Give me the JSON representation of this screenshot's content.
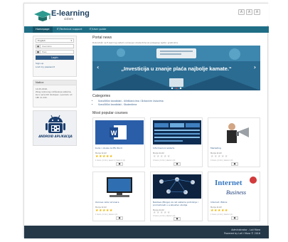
{
  "header": {
    "logo_text": "E-learning",
    "logo_sub": "sistem",
    "lang_buttons": [
      "A",
      "A",
      "A"
    ]
  },
  "nav": {
    "items": [
      "Homepage",
      "IT/Technical support",
      "IT/User guide"
    ]
  },
  "sidebar": {
    "language_select": "English",
    "username_placeholder": "Username",
    "password_placeholder": "Pass",
    "login_button": "Login",
    "signup_link": "Sign up",
    "forgot_link": "Lost my password",
    "notice_title": "Notice",
    "notice_date": "14.05.2016.",
    "notice_text": "Zbog redovnog održavanja sistema, kurs neće biti dostupan u periodu od 18h do 22h.",
    "android_text": "ANDROID APLIKACIJA"
  },
  "main": {
    "portal_title": "Portal news",
    "portal_sub": "Dobrodošli na E-learning sistem namenjen studentima za polaganje ispita i gradivima.",
    "banner_text": "„Investicija u znanje plaća najbolje kamate.“",
    "banner_prev": "‹",
    "banner_next": "›",
    "categories_title": "Categories",
    "categories": [
      "Sveučilišni kandidati - Učešćanicima i Državnim Uslovima",
      "Sveučilišni kandidati - Studentima"
    ],
    "courses_title": "Most popular courses",
    "courses": [
      {
        "title": "Kursi i obuke za MS Word",
        "sub": "Marija Krstić",
        "rated": true,
        "meta": "1 hours | 0 min | Level: 4 | Users in (1)"
      },
      {
        "title": "Informacioni sistemi",
        "sub": "Marija Krstić",
        "rated": false,
        "meta": "0 hours | 0 min | Users in (0)"
      },
      {
        "title": "Marketing",
        "sub": "Marija Krstić",
        "rated": false,
        "meta": "0 hours | 0 min | Users in (0)"
      },
      {
        "title": "Osnove rada računara",
        "sub": "Marija Krstić",
        "rated": true,
        "meta": "1 hours | 0 min | Users in (1)"
      },
      {
        "title": "Nastava (Bloga) za rad sistema potrošnja i prometnosti u e-Iskustvu studija",
        "sub": "Marija Krstić",
        "rated": false,
        "meta": "0 hours | 0 min | Users in (0)"
      },
      {
        "title": "Internet i Biznis",
        "sub": "Marija Krstić",
        "rated": true,
        "meta": "1 hours | 0 min | Users in (1)"
      }
    ]
  },
  "footer": {
    "line1": "Administrator - Lali Mara",
    "line2": "Powered by Lali i Mara © 2016"
  },
  "colors": {
    "navbar": "#1f6e86",
    "banner": "#2b6c92",
    "footer": "#253848",
    "star": "#f0b400"
  }
}
